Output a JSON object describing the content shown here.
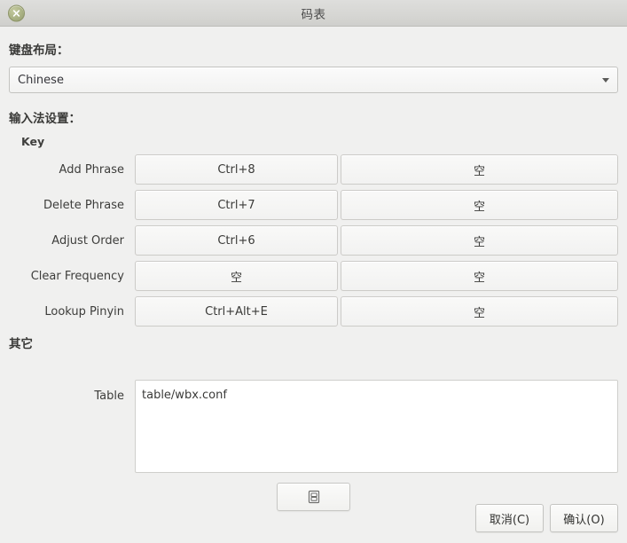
{
  "window": {
    "title": "码表",
    "close_icon": "close-icon"
  },
  "keyboard_layout": {
    "heading": "键盘布局：",
    "selected": "Chinese",
    "dropdown_icon": "chevron-down-icon"
  },
  "ime_settings": {
    "heading": "输入法设置：",
    "group_label": "Key",
    "rows": [
      {
        "label": "Add Phrase",
        "primary": "Ctrl+8",
        "secondary": "空"
      },
      {
        "label": "Delete Phrase",
        "primary": "Ctrl+7",
        "secondary": "空"
      },
      {
        "label": "Adjust Order",
        "primary": "Ctrl+6",
        "secondary": "空"
      },
      {
        "label": "Clear Frequency",
        "primary": "空",
        "secondary": "空"
      },
      {
        "label": "Lookup Pinyin",
        "primary": "Ctrl+Alt+E",
        "secondary": "空"
      }
    ]
  },
  "other": {
    "heading": "其它",
    "table_label": "Table",
    "table_value": "table/wbx.conf",
    "browse_icon": "file-card-icon"
  },
  "footer": {
    "cancel_label": "取消(C)",
    "confirm_label": "确认(O)"
  },
  "colors": {
    "titlebar": "#d6d6d3",
    "background": "#f0f0ef",
    "close_button": "#9aa276",
    "field_background": "#ffffff",
    "border": "#c7c7c4",
    "text": "#3a3a38"
  }
}
